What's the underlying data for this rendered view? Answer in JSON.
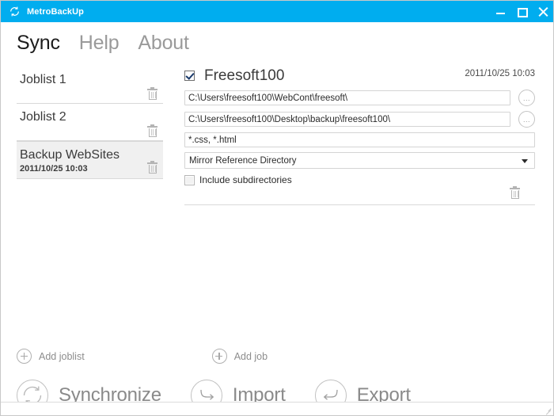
{
  "window": {
    "title": "MetroBackUp",
    "logo_icon": "refresh-circle-icon",
    "minimize_icon": "minimize-icon",
    "maximize_icon": "maximize-icon",
    "close_icon": "close-icon",
    "accent_color": "#00adef"
  },
  "tabs": [
    {
      "label": "Sync",
      "active": true
    },
    {
      "label": "Help",
      "active": false
    },
    {
      "label": "About",
      "active": false
    }
  ],
  "sidebar": {
    "items": [
      {
        "name": "Joblist 1",
        "date": "",
        "selected": false,
        "delete_icon": "trash-icon"
      },
      {
        "name": "Joblist 2",
        "date": "",
        "selected": false,
        "delete_icon": "trash-icon"
      },
      {
        "name": "Backup WebSites",
        "date": "2011/10/25 10:03",
        "selected": true,
        "delete_icon": "trash-icon"
      }
    ],
    "add_joblist": {
      "label": "Add joblist",
      "icon": "plus-circle-icon"
    }
  },
  "job_panel": {
    "add_job": {
      "label": "Add job",
      "icon": "plus-circle-icon"
    },
    "job": {
      "enabled": true,
      "checkbox_icon": "checkbox-checked-icon",
      "title": "Freesoft100",
      "date": "2011/10/25 10:03",
      "source_path": "C:\\Users\\freesoft100\\WebCont\\freesoft\\",
      "source_browse_label": "...",
      "source_browse_icon": "ellipsis-button-icon",
      "target_path": "C:\\Users\\freesoft100\\Desktop\\backup\\freesoft100\\",
      "target_browse_label": "...",
      "target_browse_icon": "ellipsis-button-icon",
      "filter": "*.css, *.html",
      "mode": "Mirror Reference Directory",
      "mode_caret_icon": "chevron-down-icon",
      "include_subdirectories_label": "Include subdirectories",
      "include_subdirectories_checked": false,
      "include_subdirectories_icon": "checkbox-unchecked-icon",
      "delete_icon": "trash-icon"
    }
  },
  "actions": [
    {
      "label": "Synchronize",
      "icon": "sync-circle-icon"
    },
    {
      "label": "Import",
      "icon": "import-arrow-icon"
    },
    {
      "label": "Export",
      "icon": "export-arrow-icon"
    }
  ],
  "statusbar": {
    "resize_grip_icon": "resize-grip-icon"
  }
}
